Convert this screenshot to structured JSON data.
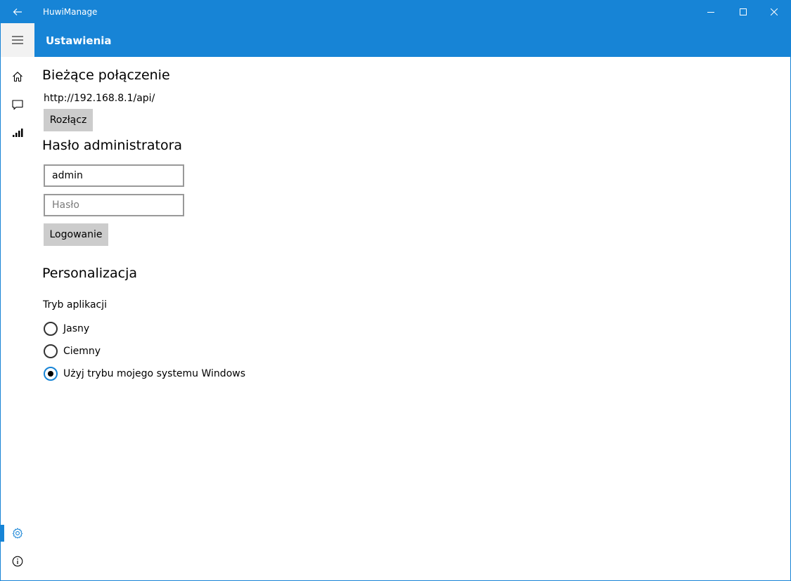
{
  "window": {
    "app_title": "HuwiManage"
  },
  "header": {
    "page_title": "Ustawienia"
  },
  "nav": {
    "items": [
      {
        "name": "home",
        "icon": "home-icon"
      },
      {
        "name": "messages",
        "icon": "chat-icon"
      },
      {
        "name": "signal",
        "icon": "signal-icon"
      },
      {
        "name": "settings",
        "icon": "gear-icon",
        "selected": true
      },
      {
        "name": "info",
        "icon": "info-icon"
      }
    ]
  },
  "connection": {
    "title": "Bieżące połączenie",
    "url": "http://192.168.8.1/api/",
    "disconnect_label": "Rozłącz"
  },
  "admin": {
    "title": "Hasło administratora",
    "username_value": "admin",
    "password_placeholder": "Hasło",
    "login_label": "Logowanie"
  },
  "personalization": {
    "title": "Personalizacja",
    "mode_label": "Tryb aplikacji",
    "options": [
      {
        "label": "Jasny",
        "checked": false
      },
      {
        "label": "Ciemny",
        "checked": false
      },
      {
        "label": "Użyj trybu mojego systemu Windows",
        "checked": true
      }
    ]
  },
  "colors": {
    "accent": "#1784d6",
    "button_bg": "#cccccc"
  }
}
